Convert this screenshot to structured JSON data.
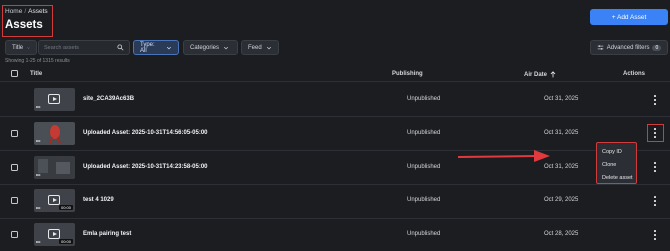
{
  "breadcrumb": {
    "home": "Home",
    "separator": "/",
    "current": "Assets"
  },
  "page_title": "Assets",
  "add_button": {
    "icon": "plus-icon",
    "label": "+ Add Asset"
  },
  "filters": {
    "title": "Title",
    "search_placeholder": "Search assets",
    "type": "Type: All",
    "categories": "Categories",
    "feed": "Feed",
    "advanced": "Advanced filters",
    "advanced_count": "0"
  },
  "showing": "Showing 1-25 of 1315 results",
  "columns": {
    "title": "Title",
    "publishing": "Publishing",
    "air_date": "Air Date",
    "actions": "Actions"
  },
  "rows": [
    {
      "title": "site_2CA39Ac63B",
      "publishing": "Unpublished",
      "air_date": "Oct 31, 2025",
      "thumb": "placeholder",
      "duration": ""
    },
    {
      "title": "Uploaded Asset: 2025-10-31T14:56:05-05:00",
      "publishing": "Unpublished",
      "air_date": "Oct 31, 2025",
      "thumb": "red-figure",
      "duration": ""
    },
    {
      "title": "Uploaded Asset: 2025-10-31T14:23:58-05:00",
      "publishing": "Unpublished",
      "air_date": "Oct 31, 2025",
      "thumb": "dark-video",
      "duration": ""
    },
    {
      "title": "test 4 1029",
      "publishing": "Unpublished",
      "air_date": "Oct 29, 2025",
      "thumb": "placeholder",
      "duration": "00:00"
    },
    {
      "title": "Emla pairing test",
      "publishing": "Unpublished",
      "air_date": "Oct 28, 2025",
      "thumb": "placeholder",
      "duration": "00:00"
    }
  ],
  "context_menu": [
    "Copy ID",
    "Clone",
    "Delete asset"
  ],
  "colors": {
    "accent": "#3b82f6",
    "highlight": "#d23b3b",
    "background": "#1b1d21"
  }
}
